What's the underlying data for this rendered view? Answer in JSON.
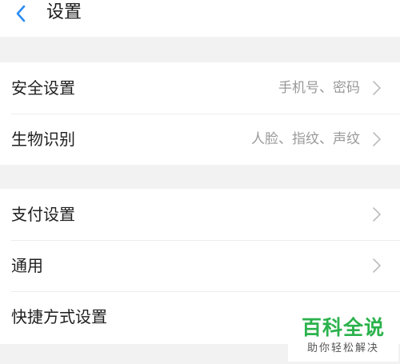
{
  "header": {
    "title": "设置",
    "back_icon": "chevron-left-icon",
    "accent": "#2b8cf2"
  },
  "sections": [
    {
      "items": [
        {
          "label": "安全设置",
          "value": "手机号、密码"
        },
        {
          "label": "生物识别",
          "value": "人脸、指纹、声纹"
        }
      ]
    },
    {
      "items": [
        {
          "label": "支付设置",
          "value": ""
        },
        {
          "label": "通用",
          "value": ""
        },
        {
          "label": "快捷方式设置",
          "value": ""
        }
      ]
    }
  ],
  "watermark": {
    "main": "百科全说",
    "sub": "助你轻松解决",
    "color": "#2bb24c"
  }
}
